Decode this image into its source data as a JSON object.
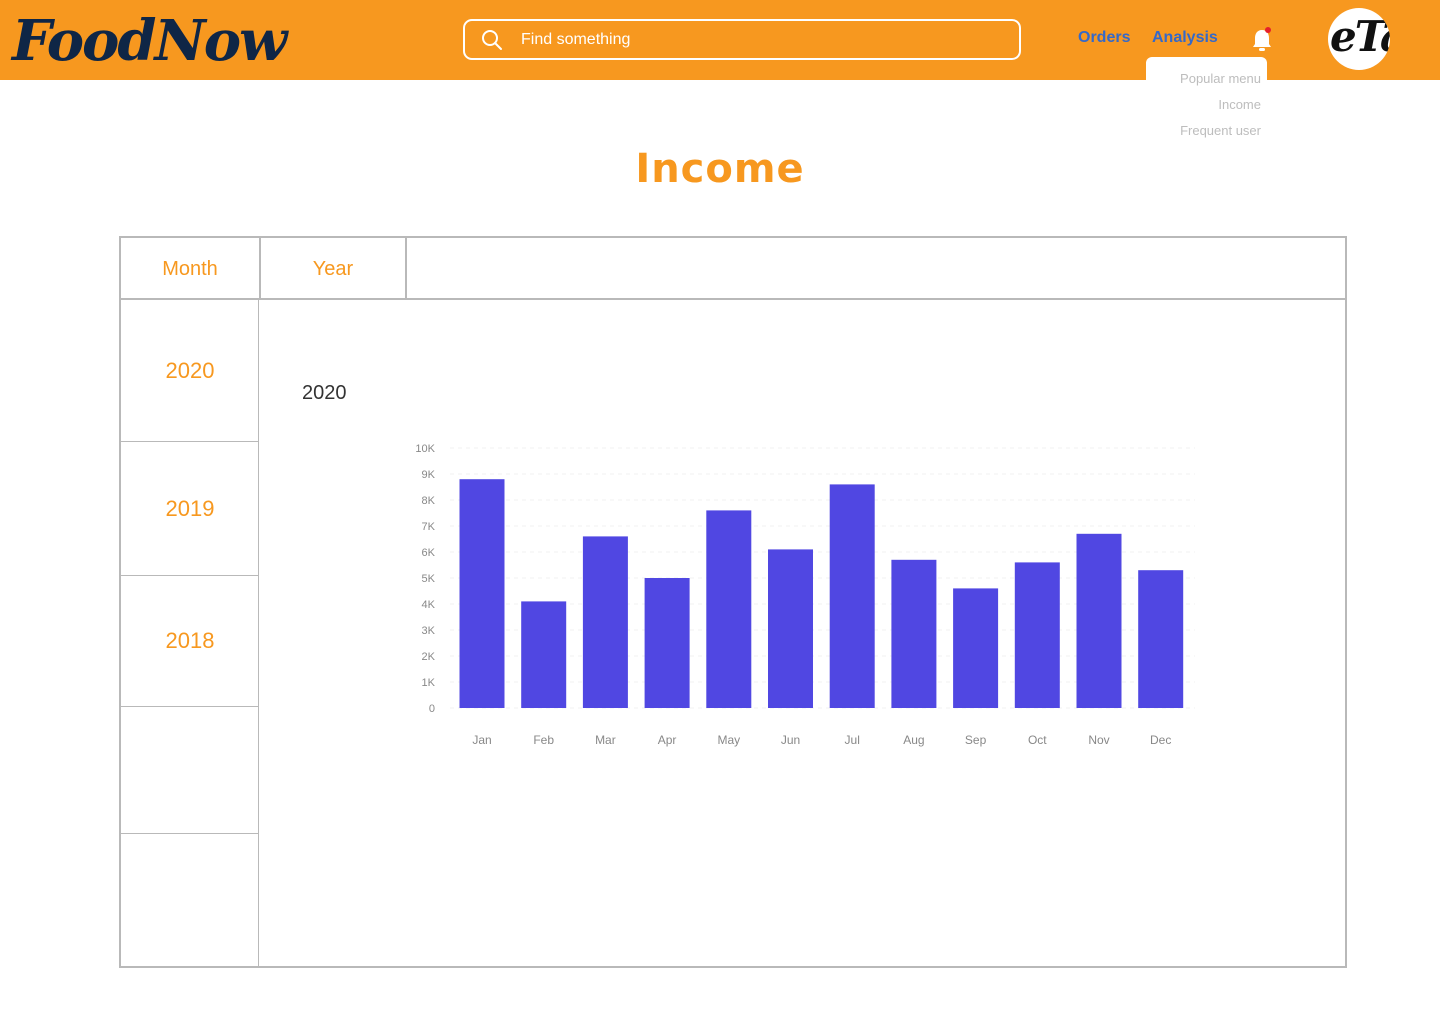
{
  "header": {
    "logo": "FoodNow",
    "search_placeholder": "Find something",
    "nav": {
      "orders": "Orders",
      "analysis": "Analysis"
    },
    "avatar_text": "eTal",
    "colors": {
      "bar": "#f7981f",
      "nav_link": "#3569c9",
      "logo": "#0f2646"
    }
  },
  "dropdown": {
    "items": [
      "Popular menu",
      "Income",
      "Frequent user"
    ]
  },
  "page": {
    "title": "Income"
  },
  "tabs": {
    "month": "Month",
    "year": "Year"
  },
  "years": [
    "2020",
    "2019",
    "2018"
  ],
  "chart_data": {
    "type": "bar",
    "title": "2020",
    "categories": [
      "Jan",
      "Feb",
      "Mar",
      "Apr",
      "May",
      "Jun",
      "Jul",
      "Aug",
      "Sep",
      "Oct",
      "Nov",
      "Dec"
    ],
    "values": [
      8800,
      4100,
      6600,
      5000,
      7600,
      6100,
      8600,
      5700,
      4600,
      5600,
      6700,
      5300
    ],
    "ylim": [
      0,
      10000
    ],
    "yticks": [
      "0",
      "1K",
      "2K",
      "3K",
      "4K",
      "5K",
      "6K",
      "7K",
      "8K",
      "9K",
      "10K"
    ],
    "bar_color": "#5047e2",
    "grid": true
  }
}
